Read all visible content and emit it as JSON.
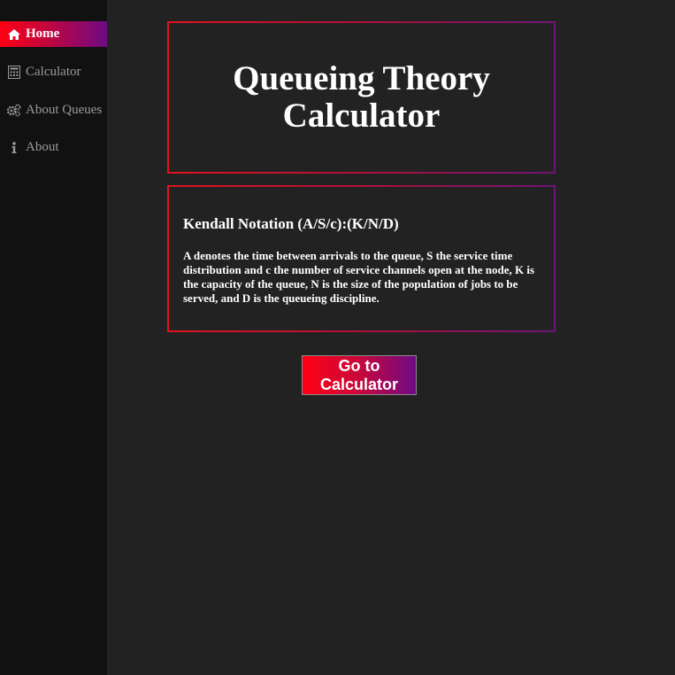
{
  "sidebar": {
    "items": [
      {
        "label": "Home",
        "icon": "home-icon",
        "active": true
      },
      {
        "label": "Calculator",
        "icon": "calculator-icon",
        "active": false
      },
      {
        "label": "About Queues",
        "icon": "gears-icon",
        "active": false
      },
      {
        "label": "About",
        "icon": "info-icon",
        "active": false
      }
    ]
  },
  "main": {
    "title": "Queueing Theory Calculator",
    "info": {
      "heading": "Kendall Notation (A/S/c):(K/N/D)",
      "body": "A denotes the time between arrivals to the queue, S the service time distribution and c the number of service channels open at the node, K is the capacity of the queue, N is the size of the population of jobs to be served, and D is the queueing discipline."
    },
    "cta_label": "Go to Calculator"
  },
  "colors": {
    "background": "#222222",
    "sidebar": "#111111",
    "accent_start": "#ff0014",
    "accent_end": "#6e0a82",
    "nav_text": "#9a9a9a"
  }
}
